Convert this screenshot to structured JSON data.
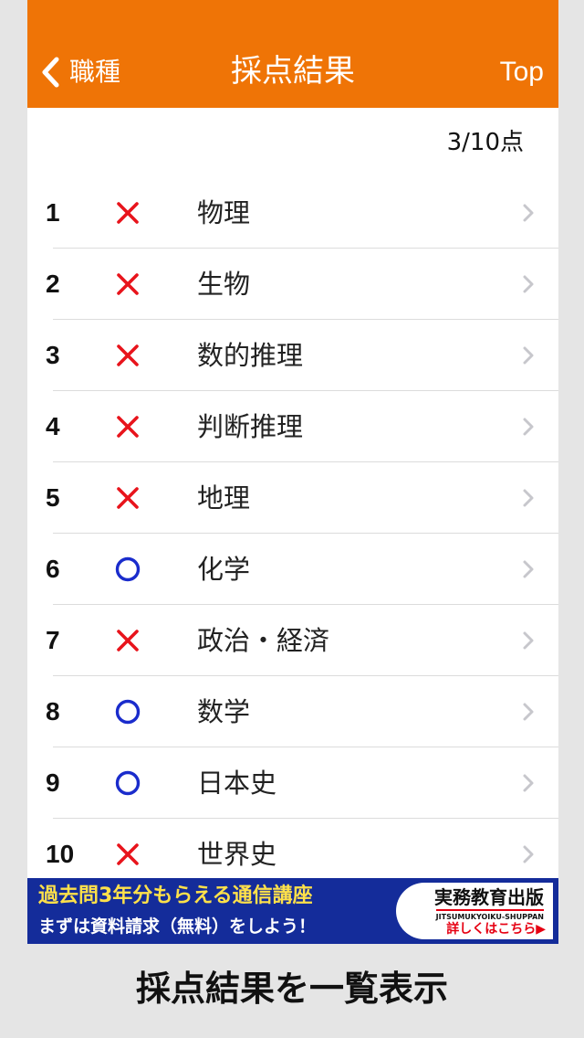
{
  "navbar": {
    "back_label": "職種",
    "title": "採点結果",
    "top_label": "Top"
  },
  "score": "3/10点",
  "results": [
    {
      "number": "1",
      "result": "incorrect",
      "subject": "物理"
    },
    {
      "number": "2",
      "result": "incorrect",
      "subject": "生物"
    },
    {
      "number": "3",
      "result": "incorrect",
      "subject": "数的推理"
    },
    {
      "number": "4",
      "result": "incorrect",
      "subject": "判断推理"
    },
    {
      "number": "5",
      "result": "incorrect",
      "subject": "地理"
    },
    {
      "number": "6",
      "result": "correct",
      "subject": "化学"
    },
    {
      "number": "7",
      "result": "incorrect",
      "subject": "政治・経済"
    },
    {
      "number": "8",
      "result": "correct",
      "subject": "数学"
    },
    {
      "number": "9",
      "result": "correct",
      "subject": "日本史"
    },
    {
      "number": "10",
      "result": "incorrect",
      "subject": "世界史"
    }
  ],
  "banner": {
    "line1": "過去問3年分もらえる通信講座",
    "line2": "まずは資料請求（無料）をしよう！",
    "publisher_name": "実務教育出版",
    "publisher_roman": "JITSUMUKYOIKU-SHUPPAN",
    "link_text": "詳しくはこちら▶"
  },
  "caption": "採点結果を一覧表示",
  "icons": {
    "correct": "circle-icon",
    "incorrect": "cross-icon",
    "back": "chevron-left-icon",
    "row": "chevron-right-icon"
  },
  "colors": {
    "accent": "#ef7406",
    "correct": "#1a2ccc",
    "incorrect": "#e8141c",
    "banner_bg": "#142c9a",
    "banner_highlight": "#ffe14a",
    "chevron": "#c7c7cc"
  }
}
